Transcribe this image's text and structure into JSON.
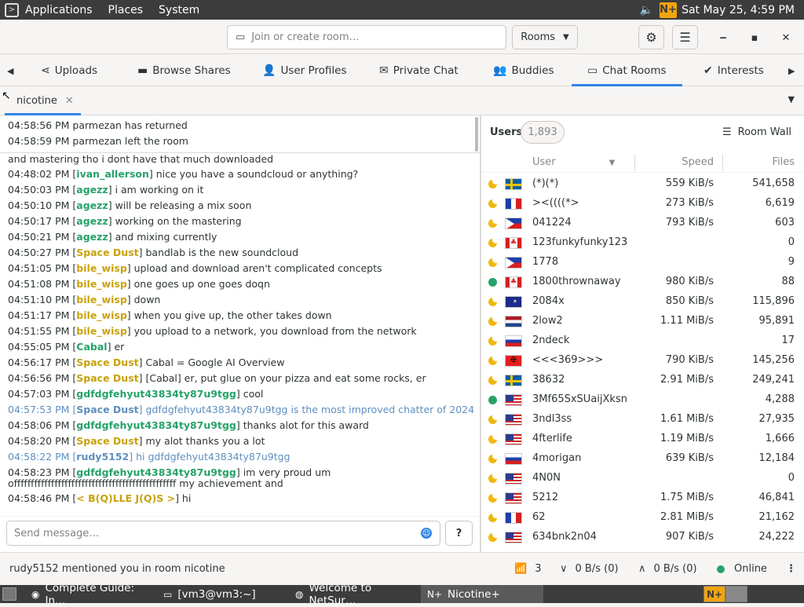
{
  "topbar": {
    "menus": [
      "Applications",
      "Places",
      "System"
    ],
    "clock": "Sat May 25,  4:59 PM",
    "app_badge": "N+"
  },
  "header": {
    "search_placeholder": "Join or create room…",
    "rooms_label": "Rooms"
  },
  "tabs": [
    {
      "label": "Uploads",
      "icon": "share-icon"
    },
    {
      "label": "Browse Shares",
      "icon": "folder-icon"
    },
    {
      "label": "User Profiles",
      "icon": "user-icon"
    },
    {
      "label": "Private Chat",
      "icon": "mail-icon"
    },
    {
      "label": "Buddies",
      "icon": "add-user-icon"
    },
    {
      "label": "Chat Rooms",
      "icon": "chat-icon"
    },
    {
      "label": "Interests",
      "icon": "check-circle-icon"
    }
  ],
  "room_tab": {
    "label": "nicotine"
  },
  "status_log": [
    "04:58:56 PM parmezan has returned",
    "04:58:59 PM parmezan left the room"
  ],
  "chat": [
    {
      "time": "",
      "user": "",
      "text": "and mastering tho i dont have that much downloaded",
      "uc": "",
      "me": false
    },
    {
      "time": "04:48:02 PM",
      "user": "ivan_allerson",
      "text": "nice you have a soundcloud or anything?",
      "uc": "#26a269",
      "me": false
    },
    {
      "time": "04:50:03 PM",
      "user": "agezz",
      "text": "i am working on it",
      "uc": "#26a269",
      "me": false
    },
    {
      "time": "04:50:10 PM",
      "user": "agezz",
      "text": "will be releasing a mix soon",
      "uc": "#26a269",
      "me": false
    },
    {
      "time": "04:50:17 PM",
      "user": "agezz",
      "text": "working on the mastering",
      "uc": "#26a269",
      "me": false
    },
    {
      "time": "04:50:21 PM",
      "user": "agezz",
      "text": "and mixing currently",
      "uc": "#26a269",
      "me": false
    },
    {
      "time": "04:50:27 PM",
      "user": "Space Dust",
      "text": "bandlab is the new soundcloud",
      "uc": "#c8a20a",
      "me": false
    },
    {
      "time": "04:51:05 PM",
      "user": "bile_wisp",
      "text": "upload and download aren't complicated concepts",
      "uc": "#c8a20a",
      "me": false
    },
    {
      "time": "04:51:08 PM",
      "user": "bile_wisp",
      "text": "one goes up one goes doqn",
      "uc": "#c8a20a",
      "me": false
    },
    {
      "time": "04:51:10 PM",
      "user": "bile_wisp",
      "text": "down",
      "uc": "#c8a20a",
      "me": false
    },
    {
      "time": "04:51:17 PM",
      "user": "bile_wisp",
      "text": "when you give up, the other takes down",
      "uc": "#c8a20a",
      "me": false
    },
    {
      "time": "04:51:55 PM",
      "user": "bile_wisp",
      "text": "you upload to a network, you download from the network",
      "uc": "#c8a20a",
      "me": false
    },
    {
      "time": "04:55:05 PM",
      "user": "Cabal",
      "text": "er",
      "uc": "#26a269",
      "me": false
    },
    {
      "time": "04:56:17 PM",
      "user": "Space Dust",
      "text": "Cabal = Google AI Overview",
      "uc": "#c8a20a",
      "me": false
    },
    {
      "time": "04:56:56 PM",
      "user": "Space Dust",
      "text": "[Cabal] er, put glue on your pizza and eat some rocks, er",
      "uc": "#c8a20a",
      "me": false
    },
    {
      "time": "04:57:03 PM",
      "user": "gdfdgfehyut43834ty87u9tgg",
      "text": "cool",
      "uc": "#26a269",
      "me": false
    },
    {
      "time": "04:57:53 PM",
      "user": "Space Dust",
      "text": "gdfdgfehyut43834ty87u9tgg is the most improved chatter of 2024",
      "uc": "#c8a20a",
      "me": true
    },
    {
      "time": "04:58:06 PM",
      "user": "gdfdgfehyut43834ty87u9tgg",
      "text": "thanks alot for this award",
      "uc": "#26a269",
      "me": false
    },
    {
      "time": "04:58:20 PM",
      "user": "Space Dust",
      "text": "my alot thanks you a lot",
      "uc": "#c8a20a",
      "me": false
    },
    {
      "time": "04:58:22 PM",
      "user": "rudy5152",
      "text": "hi gdfdgfehyut43834ty87u9tgg",
      "uc": "#26a269",
      "me": true
    },
    {
      "time": "04:58:23 PM",
      "user": "gdfdgfehyut43834ty87u9tgg",
      "text": "im very proud um",
      "uc": "#26a269",
      "me": false
    },
    {
      "time": "",
      "user": "",
      "text": "offffffffffffffffffffffffffffffffffffffffffffffff my achievement and",
      "uc": "",
      "me": false
    },
    {
      "time": "04:58:46 PM",
      "user": "<  B(Q)LLE  J(Q)S  >",
      "text": "hi",
      "uc": "#c8a20a",
      "me": false
    }
  ],
  "compose": {
    "placeholder": "Send message…"
  },
  "users_panel": {
    "label": "Users",
    "count": "1,893",
    "room_wall": "Room Wall",
    "col_user": "User",
    "col_speed": "Speed",
    "col_files": "Files"
  },
  "users": [
    {
      "status": "away",
      "flag": "se",
      "name": "(*)(*)",
      "speed": "559 KiB/s",
      "files": "541,658"
    },
    {
      "status": "away",
      "flag": "fr",
      "name": "><((((*>",
      "speed": "273 KiB/s",
      "files": "6,619"
    },
    {
      "status": "away",
      "flag": "ph",
      "name": "041224",
      "speed": "793 KiB/s",
      "files": "603"
    },
    {
      "status": "away",
      "flag": "ca",
      "name": "123funkyfunky123",
      "speed": "",
      "files": "0"
    },
    {
      "status": "away",
      "flag": "ph",
      "name": "1778",
      "speed": "",
      "files": "9"
    },
    {
      "status": "online",
      "flag": "ca",
      "name": "1800thrownaway",
      "speed": "980 KiB/s",
      "files": "88"
    },
    {
      "status": "away",
      "flag": "au",
      "name": "2084x",
      "speed": "850 KiB/s",
      "files": "115,896"
    },
    {
      "status": "away",
      "flag": "nl",
      "name": "2low2",
      "speed": "1.11 MiB/s",
      "files": "95,891"
    },
    {
      "status": "away",
      "flag": "si",
      "name": "2ndeck",
      "speed": "",
      "files": "17"
    },
    {
      "status": "away",
      "flag": "al",
      "name": "<<<369>>>",
      "speed": "790 KiB/s",
      "files": "145,256"
    },
    {
      "status": "away",
      "flag": "se",
      "name": "38632",
      "speed": "2.91 MiB/s",
      "files": "249,241"
    },
    {
      "status": "online",
      "flag": "us",
      "name": "3Mf65SxSUaijXksn",
      "speed": "",
      "files": "4,288"
    },
    {
      "status": "away",
      "flag": "us",
      "name": "3ndl3ss",
      "speed": "1.61 MiB/s",
      "files": "27,935"
    },
    {
      "status": "away",
      "flag": "us",
      "name": "4fterlife",
      "speed": "1.19 MiB/s",
      "files": "1,666"
    },
    {
      "status": "away",
      "flag": "ru",
      "name": "4morigan",
      "speed": "639 KiB/s",
      "files": "12,184"
    },
    {
      "status": "away",
      "flag": "us",
      "name": "4N0N",
      "speed": "",
      "files": "0"
    },
    {
      "status": "away",
      "flag": "us",
      "name": "5212",
      "speed": "1.75 MiB/s",
      "files": "46,841"
    },
    {
      "status": "away",
      "flag": "fr",
      "name": "62",
      "speed": "2.81 MiB/s",
      "files": "21,162"
    },
    {
      "status": "away",
      "flag": "us",
      "name": "634bnk2n04",
      "speed": "907 KiB/s",
      "files": "24,222"
    }
  ],
  "statusbar": {
    "message": "rudy5152 mentioned you in room nicotine",
    "connections": "3",
    "download": "0 B/s (0)",
    "upload": "0 B/s (0)",
    "online": "Online"
  },
  "taskbar": [
    {
      "label": "Complete Guide: In…",
      "icon": "firefox-icon"
    },
    {
      "label": "[vm3@vm3:~]",
      "icon": "terminal-icon"
    },
    {
      "label": "Welcome to NetSur…",
      "icon": "netsurf-icon"
    },
    {
      "label": "Nicotine+",
      "icon": "nicotine-icon"
    }
  ],
  "colors": {
    "accent": "#3584e4",
    "online": "#26a269",
    "away": "#f1b70e",
    "own_message": "#5f8fbf"
  }
}
